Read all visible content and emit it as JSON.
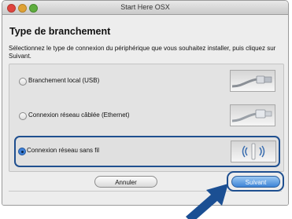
{
  "window": {
    "title": "Start Here OSX"
  },
  "page": {
    "heading": "Type de branchement",
    "instructions": "Sélectionnez le type de connexion du périphérique que vous souhaitez installer, puis cliquez sur Suivant."
  },
  "options": [
    {
      "label": "Branchement local (USB)",
      "selected": false,
      "icon": "usb-cable-icon"
    },
    {
      "label": "Connexion réseau câblée (Ethernet)",
      "selected": false,
      "icon": "ethernet-cable-icon"
    },
    {
      "label": "Connexion réseau sans fil",
      "selected": true,
      "icon": "wireless-signal-icon"
    }
  ],
  "buttons": {
    "cancel": "Annuler",
    "next": "Suivant"
  },
  "colors": {
    "highlight": "#1f4f8f",
    "arrow": "#1b4f93",
    "primary_button": "#3d84d6"
  }
}
